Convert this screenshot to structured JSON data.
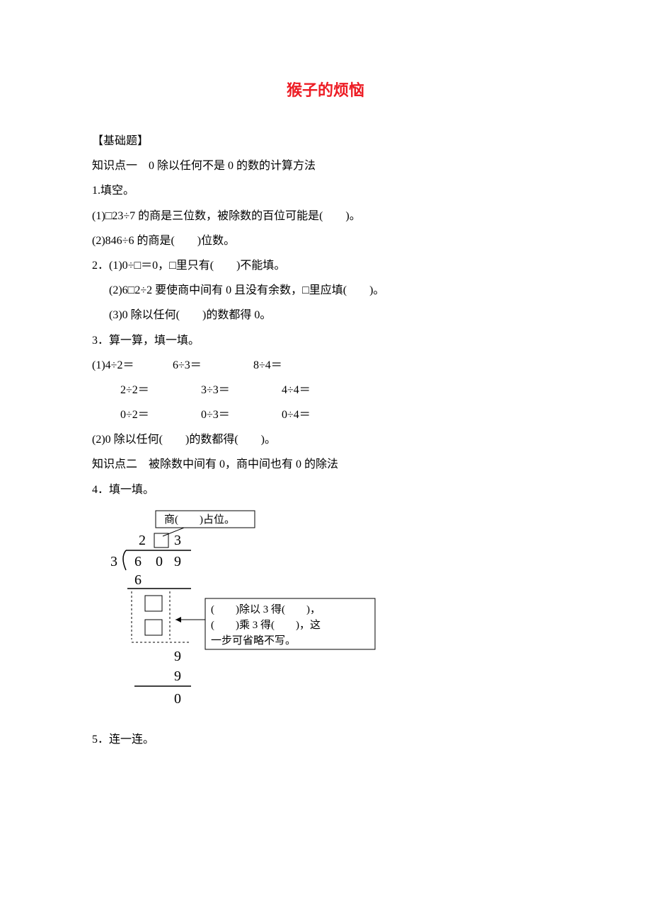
{
  "title": "猴子的烦恼",
  "section_basic": "【基础题】",
  "kp1": "知识点一　0 除以任何不是 0 的数的计算方法",
  "q1_header": "1.填空。",
  "q1_1": "(1)□23÷7 的商是三位数，被除数的百位可能是(　　)。",
  "q1_2": "(2)846÷6 的商是(　　)位数。",
  "q2_1": "2．(1)0÷□＝0，□里只有(　　)不能填。",
  "q2_2": "(2)6□2÷2 要使商中间有 0 且没有余数，□里应填(　　)。",
  "q2_3": "(3)0 除以任何(　　)的数都得 0。",
  "q3_header": "3．算一算，填一填。",
  "q3_row1a": "(1)4÷2＝",
  "q3_row1b": "6÷3＝",
  "q3_row1c": "8÷4＝",
  "q3_row2a": "2÷2＝",
  "q3_row2b": "3÷3＝",
  "q3_row2c": "4÷4＝",
  "q3_row3a": "0÷2＝",
  "q3_row3b": "0÷3＝",
  "q3_row3c": "0÷4＝",
  "q3_2": "(2)0 除以任何(　　)的数都得(　　)。",
  "kp2": "知识点二　被除数中间有 0，商中间也有 0 的除法",
  "q4_header": "4．填一填。",
  "q5_header": "5．连一连。",
  "fig": {
    "top_label": "商(　　)占位。",
    "quotient_2": "2",
    "quotient_3": "3",
    "divisor": "3",
    "dividend_6": "6",
    "dividend_0": "0",
    "dividend_9": "9",
    "sub6": "6",
    "mid9a": "9",
    "mid9b": "9",
    "final0": "0",
    "note_line1": "(　　)除以 3 得(　　)，",
    "note_line2": "(　　)乘 3 得(　　)，这",
    "note_line3": "一步可省略不写。"
  }
}
